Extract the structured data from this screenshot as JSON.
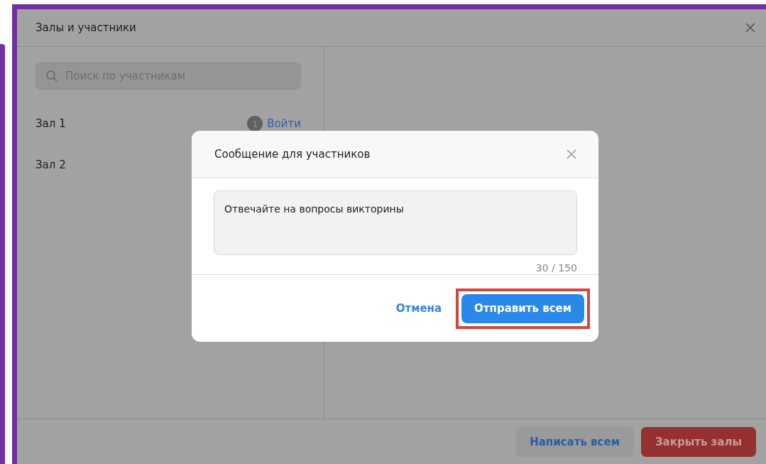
{
  "window": {
    "title": "Залы и участники"
  },
  "search": {
    "placeholder": "Поиск по участникам"
  },
  "rooms": [
    {
      "name": "Зал 1",
      "count": "1",
      "action": "Войти"
    },
    {
      "name": "Зал 2"
    }
  ],
  "footer_buttons": [
    {
      "label": "Написать всем",
      "kind": "secondary"
    },
    {
      "label": "Закрыть залы",
      "kind": "danger"
    }
  ],
  "dialog": {
    "title": "Сообщение для участников",
    "message": "Отвечайте на вопросы викторины",
    "counter": "30 / 150",
    "buttons": [
      {
        "label": "Отмена",
        "kind": "link",
        "highlighted": false
      },
      {
        "label": "Отправить всем",
        "kind": "primary",
        "highlighted": true
      }
    ]
  }
}
